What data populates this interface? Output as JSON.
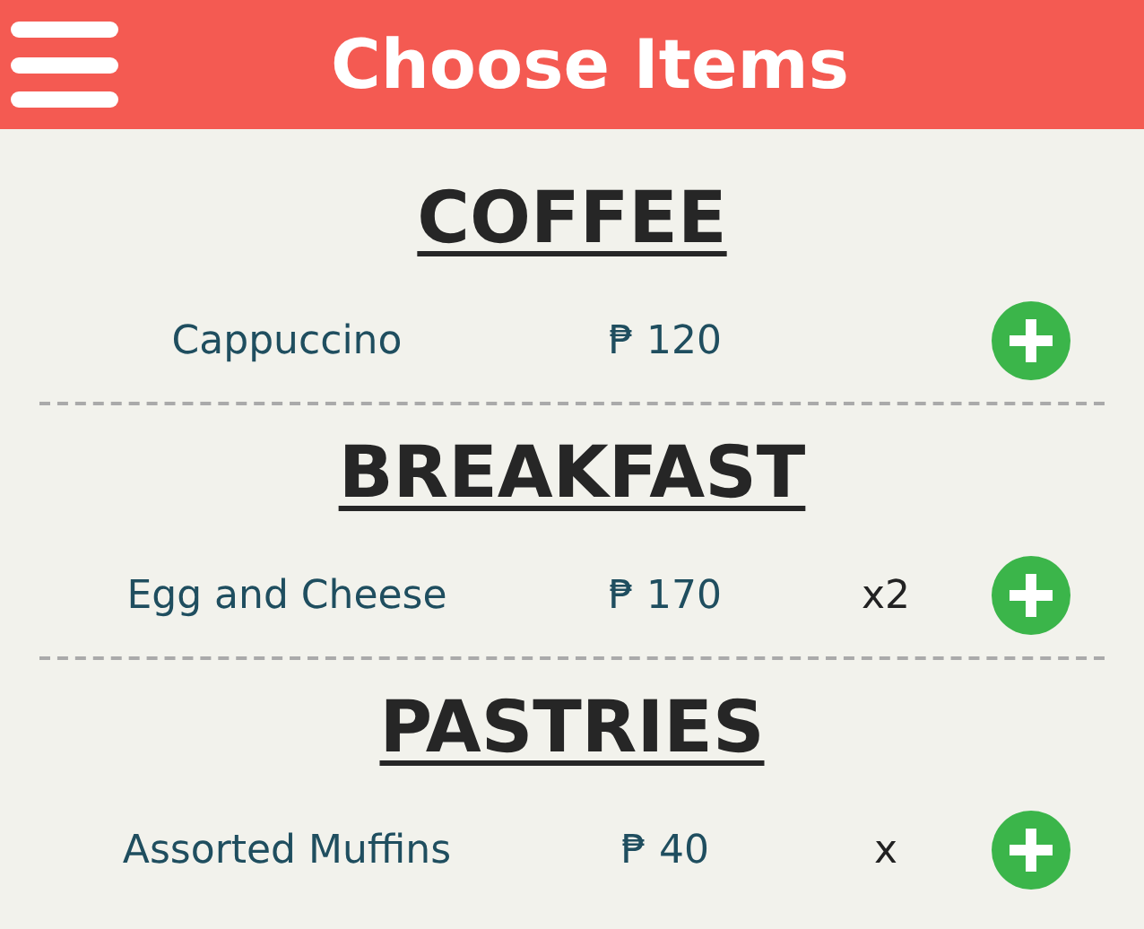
{
  "header": {
    "title": "Choose Items"
  },
  "sections": [
    {
      "title": "COFFEE",
      "items": [
        {
          "name": "Cappuccino",
          "price": "₱ 120"
        }
      ]
    },
    {
      "title": "BREAKFAST",
      "items": [
        {
          "name": "Egg and Cheese",
          "price": "₱ 170",
          "quantity": "x2"
        }
      ]
    },
    {
      "title": "PASTRIES",
      "items": [
        {
          "name": "Assorted Muffins",
          "price": "₱ 40",
          "quantity": "x"
        }
      ]
    }
  ]
}
